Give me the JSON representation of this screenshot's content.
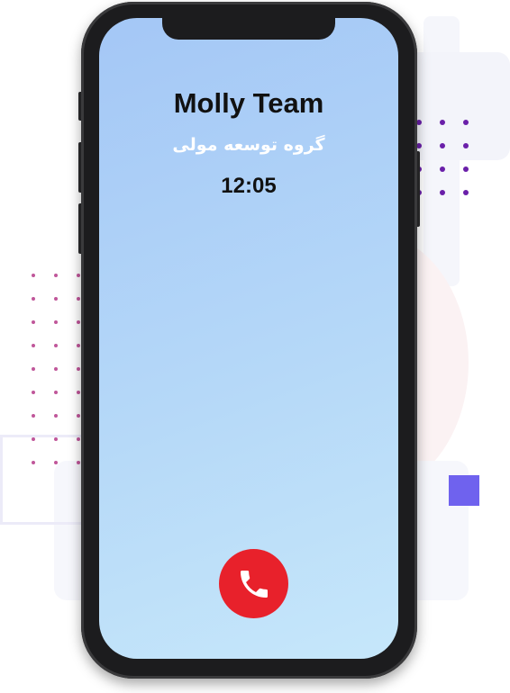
{
  "call": {
    "caller_name": "Molly Team",
    "caller_subtitle": "گروه توسعه مولی",
    "duration": "12:05"
  },
  "controls": {
    "end_call_icon": "phone-icon"
  },
  "colors": {
    "end_call": "#e8212b",
    "accent_square": "#6f62ee",
    "screen_gradient_start": "#a4c7f6",
    "screen_gradient_end": "#c6e7fa"
  }
}
